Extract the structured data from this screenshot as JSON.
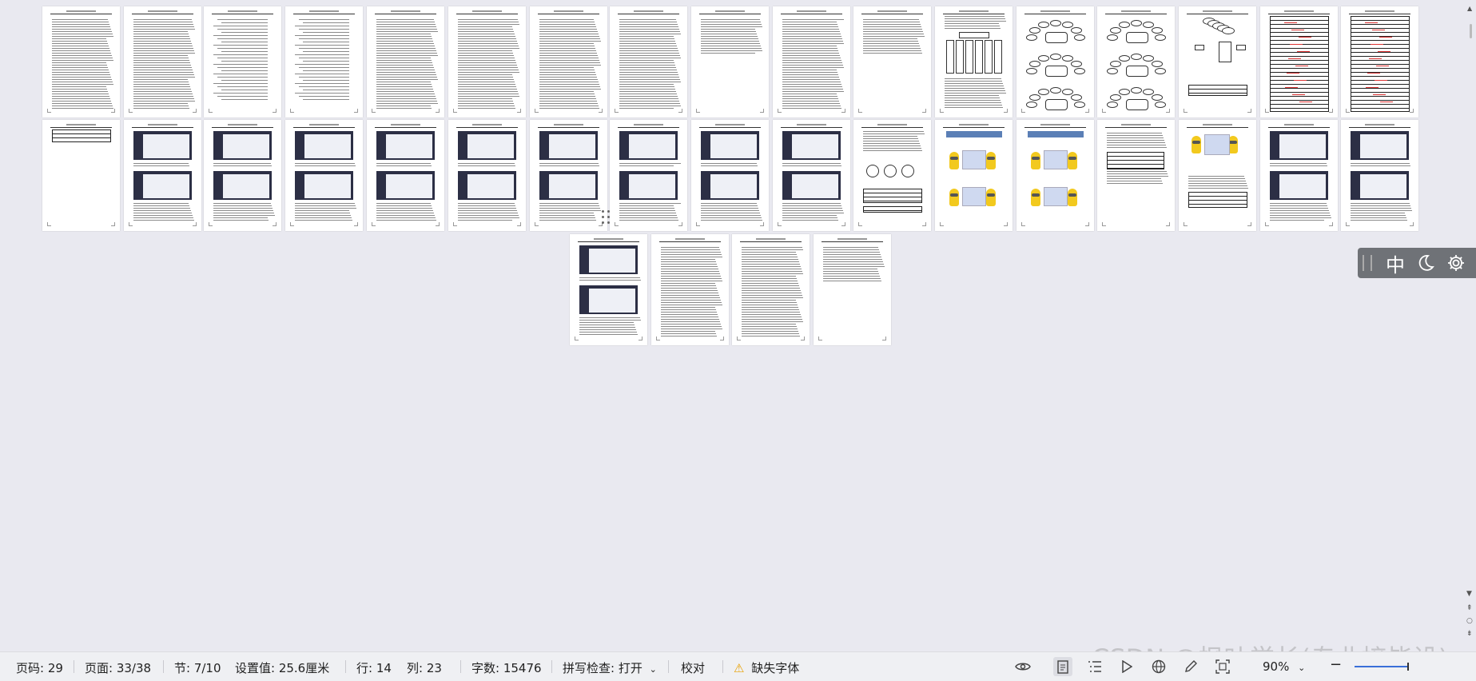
{
  "status_bar": {
    "page_code": "页码: 29",
    "pages": "页面: 33/38",
    "section": "节: 7/10",
    "setting_value": "设置值: 25.6厘米",
    "row": "行: 14",
    "column": "列: 23",
    "word_count": "字数: 15476",
    "spell_check": "拼写检查: 打开",
    "proofread": "校对",
    "missing_fonts": "缺失字体",
    "zoom": "90%"
  },
  "float_toolbar": {
    "lang": "中"
  },
  "watermark": "CSDN @枫叶学长(专业接毕设)",
  "icons": {
    "eye": "eye-icon",
    "page_view": "page-view-icon",
    "outline": "outline-icon",
    "play": "play-icon",
    "web": "globe-icon",
    "pen": "pen-icon",
    "fit": "fit-page-icon",
    "moon": "moon-icon",
    "gear": "gear-icon",
    "warning": "warning-icon"
  }
}
